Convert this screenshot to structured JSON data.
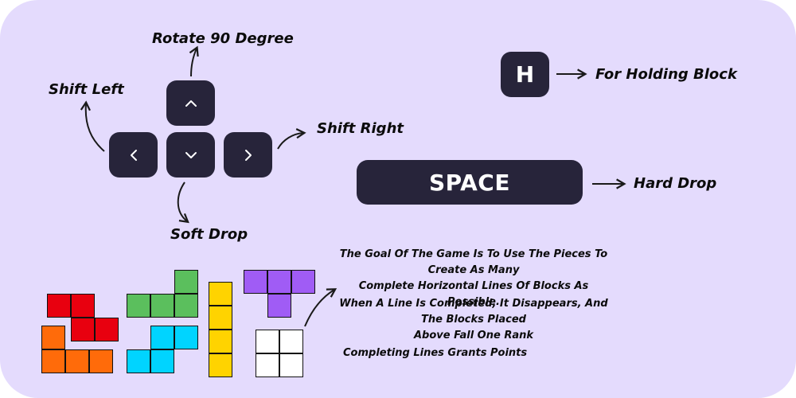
{
  "controls": {
    "rotate_label": "Rotate 90 Degree",
    "shift_left_label": "Shift Left",
    "shift_right_label": "Shift Right",
    "soft_drop_label": "Soft Drop",
    "hold_key": "H",
    "hold_label": "For Holding Block",
    "space_key": "SPACE",
    "hard_drop_label": "Hard Drop"
  },
  "rules": {
    "goal_line1": "The Goal Of The Game Is To Use The Pieces To Create As Many",
    "goal_line2": "Complete Horizontal Lines Of Blocks As Possible.",
    "clear_line1": "When A Line Is Completed, It Disappears, And The Blocks Placed",
    "clear_line2": "Above Fall One Rank",
    "points": "Completing Lines Grants Points"
  },
  "pieces": {
    "colors": {
      "z": "#e8000f",
      "l": "#ff6b0a",
      "s": "#5bbf5d",
      "j": "#00d4ff",
      "i": "#ffd300",
      "t": "#a05cf5",
      "o": "#ffffff"
    }
  },
  "theme": {
    "background": "#e4dbfd",
    "key": "#27243a"
  }
}
